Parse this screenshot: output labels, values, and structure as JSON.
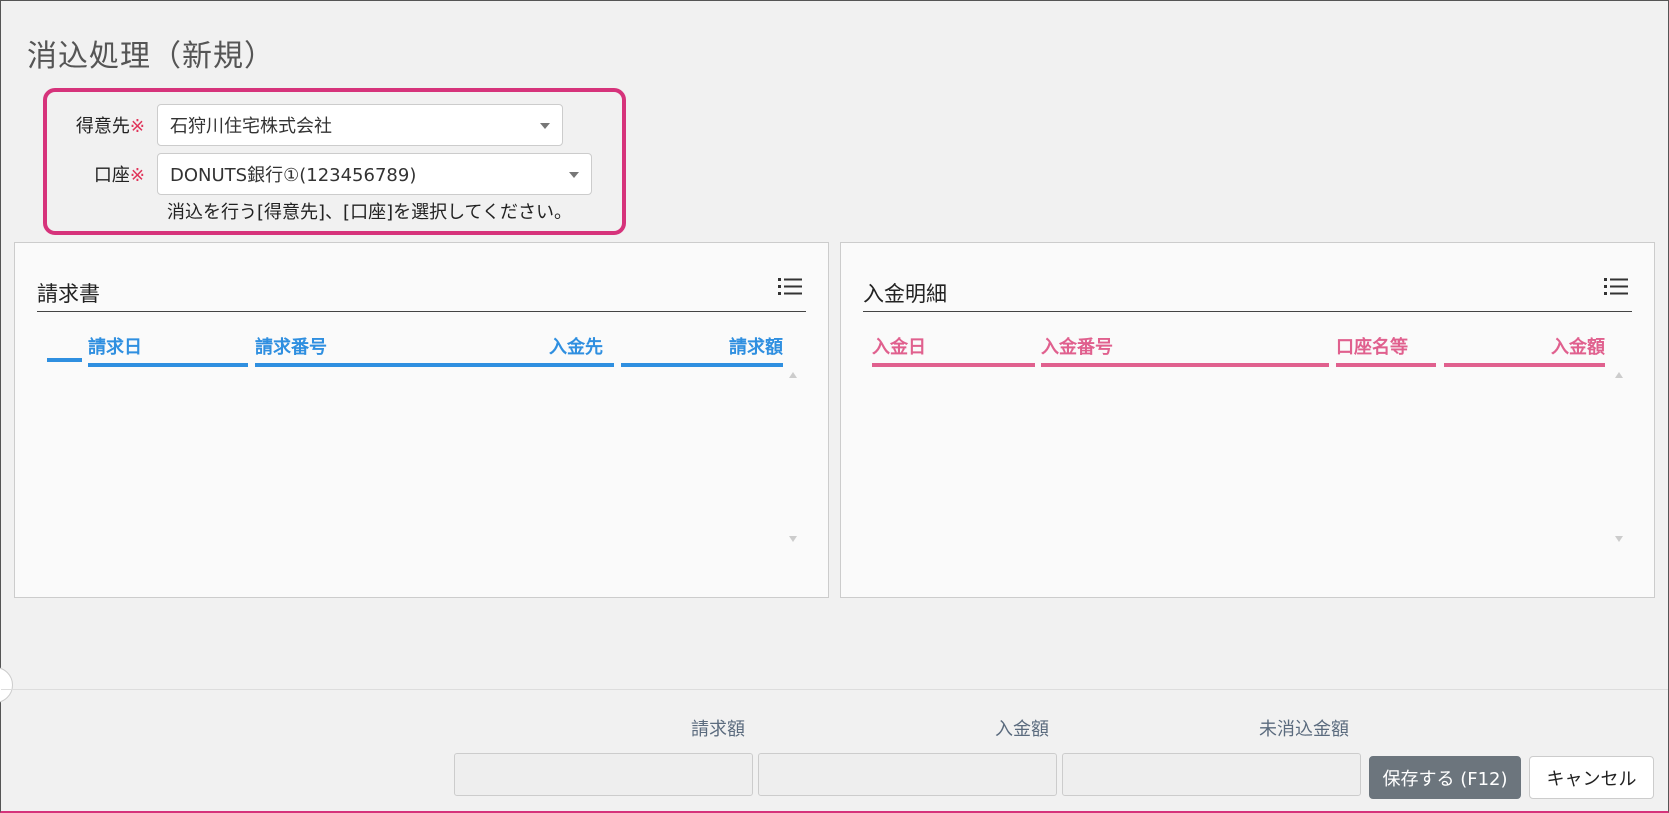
{
  "page": {
    "title": "消込処理（新規）"
  },
  "form": {
    "customer": {
      "label": "得意先",
      "required_mark": "※",
      "value": "石狩川住宅株式会社"
    },
    "account": {
      "label": "口座",
      "required_mark": "※",
      "value": "DONUTS銀行①(123456789)"
    },
    "hint": "消込を行う[得意先]、[口座]を選択してください。"
  },
  "invoice_panel": {
    "title": "請求書",
    "columns": [
      "請求日",
      "請求番号",
      "入金先",
      "請求額"
    ]
  },
  "deposit_panel": {
    "title": "入金明細",
    "columns": [
      "入金日",
      "入金番号",
      "口座名等",
      "入金額"
    ]
  },
  "summary": {
    "invoice_amount_label": "請求額",
    "deposit_amount_label": "入金額",
    "unreconciled_label": "未消込金額",
    "invoice_amount_value": "",
    "deposit_amount_value": "",
    "unreconciled_value": ""
  },
  "buttons": {
    "save": "保存する (F12)",
    "cancel": "キャンセル"
  },
  "colors": {
    "highlight": "#d6337b",
    "invoice_accent": "#2f8fe0",
    "deposit_accent": "#e0608e",
    "save_button": "#6c757d"
  },
  "icons": {
    "panel_menu": "list-icon",
    "dropdown": "caret-down-icon"
  }
}
